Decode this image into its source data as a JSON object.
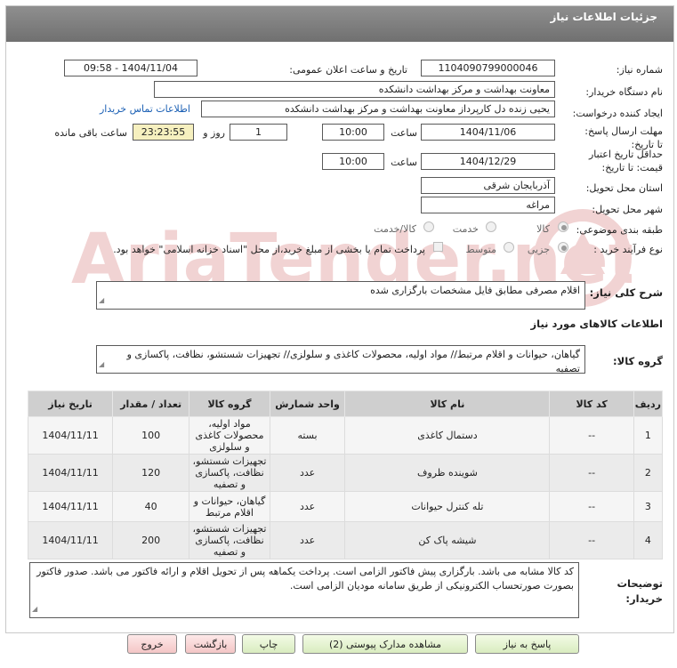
{
  "header": {
    "title": "جزئیات اطلاعات نیاز"
  },
  "watermark_text": "AriaTender.net",
  "fields": {
    "need_number_label": "شماره نیاز:",
    "need_number": "1104090799000046",
    "announce_label": "تاریخ و ساعت اعلان عمومی:",
    "announce_value": "1404/11/04 - 09:58",
    "buyer_org_label": "نام دستگاه خریدار:",
    "buyer_org": "معاونت بهداشت و مرکز بهداشت دانشکده",
    "requester_label": "ایجاد کننده درخواست:",
    "requester": "یحیی زنده دل کارپرداز معاونت بهداشت و مرکز بهداشت دانشکده",
    "contact_link": "اطلاعات تماس خریدار",
    "deadline_label": "مهلت ارسال پاسخ: تا تاریخ:",
    "deadline_date": "1404/11/06",
    "time_label": "ساعت",
    "deadline_time": "10:00",
    "days_value": "1",
    "days_label": "روز و",
    "remaining_time": "23:23:55",
    "remaining_label": "ساعت باقی مانده",
    "validity_label": "حداقل تاریخ اعتبار قیمت: تا تاریخ:",
    "validity_date": "1404/12/29",
    "validity_time": "10:00",
    "province_label": "استان محل تحویل:",
    "province": "آذربایجان شرقی",
    "city_label": "شهر محل تحویل:",
    "city": "مراغه",
    "category_label": "طبقه بندی موضوعی:",
    "category_options": [
      "کالا",
      "خدمت",
      "کالا/خدمت"
    ],
    "process_label": "نوع فرآیند خرید :",
    "process_options": [
      "جزیی",
      "متوسط"
    ],
    "treasury_note": "پرداخت تمام یا بخشی از مبلغ خرید،از محل \"اسناد خزانه اسلامی\" خواهد بود."
  },
  "summary": {
    "label": "شرح کلی نیاز:",
    "text": "اقلام مصرفی مطابق فایل مشخصات بارگزاری شده"
  },
  "goods_info_title": "اطلاعات کالاهای مورد نیاز",
  "goods_group": {
    "label": "گروه کالا:",
    "text": "گیاهان، حیوانات و اقلام مرتبط// مواد اولیه، محصولات کاغذی و سلولزی// تجهیزات شستشو، نظافت، پاکسازی و تصفیه"
  },
  "table": {
    "headers": [
      "ردیف",
      "کد کالا",
      "نام کالا",
      "واحد شمارش",
      "گروه کالا",
      "تعداد / مقدار",
      "تاریخ نیاز"
    ],
    "rows": [
      [
        "1",
        "--",
        "دستمال کاغذی",
        "بسته",
        "مواد اولیه، محصولات کاغذی و سلولزی",
        "100",
        "1404/11/11"
      ],
      [
        "2",
        "--",
        "شوینده ظروف",
        "عدد",
        "تجهیزات شستشو، نظافت، پاکسازی و تصفیه",
        "120",
        "1404/11/11"
      ],
      [
        "3",
        "--",
        "تله کنترل حیوانات",
        "عدد",
        "گیاهان، حیوانات و اقلام مرتبط",
        "40",
        "1404/11/11"
      ],
      [
        "4",
        "--",
        "شیشه پاک کن",
        "عدد",
        "تجهیزات شستشو، نظافت، پاکسازی و تصفیه",
        "200",
        "1404/11/11"
      ]
    ]
  },
  "notes": {
    "label": "توضیحات خریدار:",
    "text": "کد کالا مشابه می باشد. بارگزاری پیش فاکتور الزامی است. پرداخت یکماهه پس از تحویل اقلام و ارائه فاکتور می باشد. صدور فاکتور بصورت صورتحساب الکترونیکی از طریق سامانه مودیان الزامی است."
  },
  "buttons": {
    "reply": "پاسخ به نیاز",
    "attachments": "مشاهده مدارک پیوستی (2)",
    "print": "چاپ",
    "back": "بازگشت",
    "exit": "خروج"
  },
  "colors": {
    "header_bg": "#7f7f7f",
    "link": "#1a5fb4",
    "remaining_bg": "#f6f0bf",
    "watermark": "#e8c9c9"
  }
}
